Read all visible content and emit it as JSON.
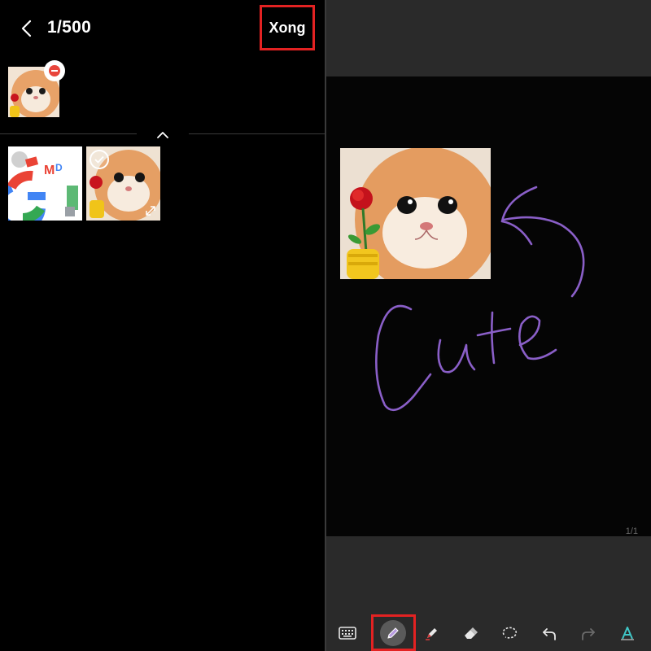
{
  "header": {
    "counter": "1/500",
    "done_label": "Xong"
  },
  "canvas": {
    "page_indicator": "1/1",
    "ink_color": "#8a5fc8",
    "handwriting": "Cute"
  },
  "toolbar": {
    "tools": [
      "keyboard-icon",
      "pen-icon",
      "highlighter-icon",
      "eraser-icon",
      "lasso-icon",
      "undo-icon",
      "redo-icon",
      "text-style-icon"
    ],
    "active_tool": "pen-icon"
  },
  "colors": {
    "highlight_box": "#e32222",
    "ink": "#8a5fc8"
  }
}
